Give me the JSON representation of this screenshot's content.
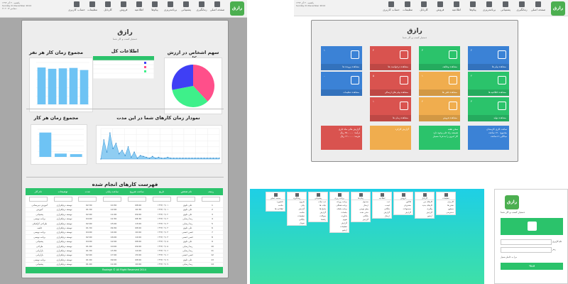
{
  "colors": {
    "green": "#2bc36b",
    "blue": "#3b82d6",
    "red": "#d9534f",
    "orange": "#f0ad4e",
    "pie_blue": "#3f3ff5",
    "pie_pink": "#ff4f8a",
    "pie_green": "#3ef08a"
  },
  "app": {
    "logo": "رازق",
    "title": "رازق",
    "subtitle": "دستیار کسب و کار شما"
  },
  "topbar": {
    "date_lines": [
      "یکشنبه ۳۰ آذر ۱۳۹۳",
      "Sunday 21 December 2014",
      "۲۱ دسامبر ۲۰۱۴"
    ],
    "nav": [
      {
        "icon": "home-icon",
        "label": "صفحه اصلی"
      },
      {
        "icon": "clock-icon",
        "label": "زمانگیری"
      },
      {
        "icon": "ticket-icon",
        "label": "پشتیبانی"
      },
      {
        "icon": "calendar-icon",
        "label": "برنامه‌ریزی"
      },
      {
        "icon": "mail-icon",
        "label": "پیام‌ها"
      },
      {
        "icon": "megaphone-icon",
        "label": "اطلاعیه"
      },
      {
        "icon": "cart-icon",
        "label": "فروش"
      },
      {
        "icon": "grid-icon",
        "label": "کارتابل"
      },
      {
        "icon": "gear-icon",
        "label": "تنظیمات"
      },
      {
        "icon": "user-icon",
        "label": "حساب کاربری"
      }
    ]
  },
  "dashboard": {
    "pie_title": "سهم اشخاص در ارزش کل",
    "info_title": "اطلاعات کل",
    "per_person_title": "مجموع زمان کار هر نفر",
    "per_job_title": "مجموع زمان هر کار",
    "timeline_title": "نمودار زمان کارهای شما در این مدت",
    "table_title": "فهرست کارهای انجام شده",
    "table_headers": [
      "ردیف",
      "نام شخص",
      "تاریخ",
      "ساعت شروع",
      "ساعت پایان",
      "مدت",
      "توضیحات",
      "نام کار"
    ],
    "table_rows": [
      [
        "1",
        "علی علوی",
        "۱۳۹۳/۰۹/۰۱",
        "08:00",
        "10:30",
        "02:30",
        "توسعه نرم‌افزاری",
        "آموزش دبیرستانی"
      ],
      [
        "2",
        "علی علوی",
        "۱۳۹۳/۰۹/۰۱",
        "10:30",
        "12:00",
        "01:30",
        "توسعه نرم‌افزاری",
        "آموزش"
      ],
      [
        "3",
        "علی علوی",
        "۱۳۹۳/۰۹/۰۲",
        "09:00",
        "11:00",
        "02:00",
        "توسعه نرم‌افزاری",
        "پشتیبانی"
      ],
      [
        "4",
        "رضا رضایی",
        "۱۳۹۳/۰۹/۰۲",
        "08:30",
        "12:30",
        "04:00",
        "توسعه نرم‌افزاری",
        "برنامه نویسی"
      ],
      [
        "5",
        "رضا رضایی",
        "۱۳۹۳/۰۹/۰۳",
        "13:00",
        "15:00",
        "02:00",
        "توسعه نرم‌افزاری",
        "طراحی گرافیکی"
      ],
      [
        "6",
        "علی علوی",
        "۱۳۹۳/۰۹/۰۳",
        "08:00",
        "09:30",
        "01:30",
        "توسعه نرم‌افزاری",
        "جلسه"
      ],
      [
        "7",
        "حسن حسنی",
        "۱۳۹۳/۰۹/۰۴",
        "10:00",
        "14:00",
        "04:00",
        "توسعه نرم‌افزاری",
        "برنامه نویسی"
      ],
      [
        "8",
        "حسن حسنی",
        "۱۳۹۳/۰۹/۰۴",
        "14:00",
        "16:00",
        "02:00",
        "توسعه نرم‌افزاری",
        "برنامه نویسی"
      ],
      [
        "9",
        "علی علوی",
        "۱۳۹۳/۰۹/۰۵",
        "08:00",
        "12:00",
        "04:00",
        "توسعه نرم‌افزاری",
        "پشتیبانی"
      ],
      [
        "10",
        "رضا رضایی",
        "۱۳۹۳/۰۹/۰۵",
        "09:00",
        "10:00",
        "01:00",
        "توسعه نرم‌افزاری",
        "طراحی"
      ],
      [
        "11",
        "رضا رضایی",
        "۱۳۹۳/۰۹/۰۶",
        "12:00",
        "13:30",
        "01:30",
        "توسعه نرم‌افزاری",
        "بازاریابی"
      ],
      [
        "12",
        "حسن حسنی",
        "۱۳۹۳/۰۹/۰۶",
        "15:00",
        "17:00",
        "02:00",
        "توسعه نرم‌افزاری",
        "بازاریابی"
      ],
      [
        "13",
        "علی علوی",
        "۱۳۹۳/۰۹/۰۷",
        "08:00",
        "09:00",
        "01:00",
        "توسعه نرم‌افزاری",
        "برنامه نویسی"
      ],
      [
        "14",
        "رضا رضایی",
        "۱۳۹۳/۰۹/۰۷",
        "10:00",
        "11:00",
        "01:00",
        "توسعه نرم‌افزاری",
        "پشتیبانی"
      ]
    ],
    "paging": "۱ از ۲۱",
    "footer": "Raziegh © All Right Reserved 2014"
  },
  "chart_data": [
    {
      "type": "bar",
      "title": "مجموع زمان کار هر نفر",
      "categories": [
        "1",
        "2",
        "3",
        "4",
        "5"
      ],
      "values": [
        88,
        85,
        86,
        87,
        82
      ],
      "ylim": [
        0,
        100
      ]
    },
    {
      "type": "pie",
      "title": "سهم اشخاص در ارزش کل",
      "categories": [
        "a",
        "b",
        "c"
      ],
      "values": [
        38,
        34,
        28
      ]
    },
    {
      "type": "bar",
      "title": "مجموع زمان هر کار",
      "categories": [
        "1",
        "2",
        "3"
      ],
      "values": [
        88,
        12,
        10
      ],
      "ylim": [
        0,
        100
      ]
    },
    {
      "type": "area",
      "title": "نمودار زمان کارهای شما در این مدت",
      "x": [
        1,
        2,
        3,
        4,
        5,
        6,
        7,
        8,
        9,
        10,
        11,
        12,
        13,
        14,
        15,
        16,
        17,
        18,
        19,
        20,
        21,
        22,
        23,
        24,
        25,
        26,
        27,
        28,
        29,
        30,
        31,
        32,
        33,
        34,
        35,
        36,
        37,
        38,
        39,
        40
      ],
      "values": [
        0,
        22,
        8,
        30,
        12,
        18,
        6,
        10,
        4,
        14,
        2,
        8,
        1,
        4,
        3,
        2,
        1,
        3,
        1,
        2,
        1,
        1,
        2,
        1,
        1,
        1,
        1,
        1,
        1,
        1,
        1,
        1,
        1,
        1,
        1,
        1,
        1,
        1,
        1,
        1
      ],
      "ylim": [
        0,
        35
      ]
    }
  ],
  "tiles": [
    {
      "label": "مشاهده پیام ها",
      "value": "۲",
      "color": "#3b82d6",
      "icon": "mail-icon"
    },
    {
      "label": "مشاهده وظایف",
      "value": "۳",
      "color": "#2bc36b",
      "icon": "check-icon"
    },
    {
      "label": "مشاهده درخواست ها",
      "value": "۴",
      "color": "#d9534f",
      "icon": "share-icon"
    },
    {
      "label": "مشاهده پرونده ها",
      "value": "۱",
      "color": "#3b82d6",
      "icon": "file-icon"
    },
    {
      "label": "مشاهده اطلاعیه ها",
      "value": "۲",
      "color": "#2bc36b",
      "icon": "megaphone-icon"
    },
    {
      "label": "مشاهده تلفن ها",
      "value": "۱",
      "color": "#f0ad4e",
      "icon": "phone-icon"
    },
    {
      "label": "مشاهده پیام های ارسالی",
      "value": "۵",
      "color": "#d9534f",
      "icon": "plane-icon"
    },
    {
      "label": "مشاهده تنظیمات",
      "value": "۰",
      "color": "#3b82d6",
      "icon": "gear-icon"
    },
    {
      "label": "مشاهده تولید",
      "value": "۳",
      "color": "#2bc36b",
      "icon": "leaf-icon"
    },
    {
      "label": "مشاهده فروش",
      "value": "۲",
      "color": "#f0ad4e",
      "icon": "cart-icon"
    },
    {
      "label": "مشاهده زمان ها",
      "value": "۱",
      "color": "#d9534f",
      "icon": "clock-icon"
    }
  ],
  "info_blocks": [
    {
      "color": "#3b82d6",
      "lines": [
        "ساعت کاری کارمندان",
        "مجموع: ۱۲۰ ساعت",
        "میانگین: ۸ ساعت"
      ]
    },
    {
      "color": "#2bc36b",
      "lines": [
        "سخن هفته",
        "همیشه راه حلی وجود دارد",
        "کار امروز را به فردا مسپار"
      ]
    },
    {
      "color": "#f0ad4e",
      "lines": [
        "گزارش کارکرد"
      ]
    },
    {
      "color": "#d9534f",
      "lines": [
        "گزارش مالی ماه جاری",
        "درآمد: ۲۵۰۰۰۰۰ ریال",
        "هزینه: ۱۲۰۰۰۰۰ ریال"
      ]
    }
  ],
  "dropdowns": [
    {
      "head": "تنظیمات",
      "items": [
        "کاربران",
        "نقش ها",
        "سطوح",
        "دسترسی"
      ]
    },
    {
      "head": "کارتابل",
      "items": [
        "کارهای من",
        "کارهای جدید",
        "پیگیری",
        "گزارش",
        "آرشیو"
      ]
    },
    {
      "head": "فروش",
      "items": [
        "فاکتور",
        "مشتریان",
        "محصولات",
        "گزارش"
      ]
    },
    {
      "head": "اطلاعیه",
      "items": [
        "ثبت",
        "لیست",
        "بایگانی",
        "گزارش",
        "ارسال"
      ]
    },
    {
      "head": "پیام ها",
      "items": [
        "صندوق",
        "ارسال",
        "پیش نویس",
        "حذف شده",
        "بایگانی",
        "گزارش"
      ]
    },
    {
      "head": "برنامه ریزی",
      "items": [
        "برنامه روزانه",
        "برنامه هفتگی",
        "برنامه ماهانه",
        "جلسات",
        "یادآوری",
        "تقویم",
        "گزارش",
        "تنظیمات",
        "آرشیو"
      ]
    },
    {
      "head": "پشتیبانی",
      "items": [
        "ثبت تیکت",
        "تیکت ها",
        "پاسخ ها",
        "گزارش",
        "سوالات",
        "راهنما"
      ]
    },
    {
      "head": "زمانگیری",
      "items": [
        "شروع",
        "پایان",
        "گزارش",
        "خلاصه",
        "تنظیمات",
        "بایگانی",
        "نمودار"
      ]
    },
    {
      "head": "صفحه اصلی",
      "items": [
        "داشبورد",
        "خلاصه",
        "اطلاعیه ها"
      ]
    }
  ],
  "login": {
    "logo": "رازق",
    "subtitle": "دستیار کسب و کار شما",
    "username_label": "نام کاربری",
    "password_label": "رمز",
    "remember": "مرا به خاطر بسپار",
    "submit": "ورود"
  }
}
